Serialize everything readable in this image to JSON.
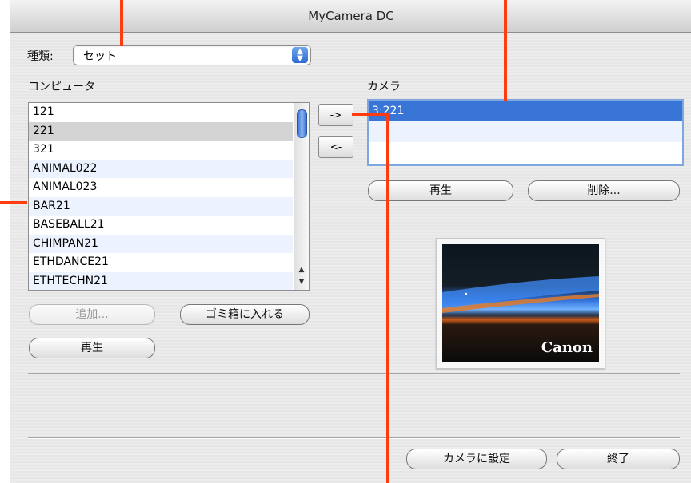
{
  "window": {
    "title": "MyCamera DC"
  },
  "kind": {
    "label": "種類:",
    "value": "セット"
  },
  "computer": {
    "label": "コンピュータ",
    "items": [
      "121",
      "221",
      "321",
      "ANIMAL022",
      "ANIMAL023",
      "BAR21",
      "BASEBALL21",
      "CHIMPAN21",
      "ETHDANCE21",
      "ETHTECHN21"
    ],
    "selected": "221"
  },
  "transfer": {
    "to_camera": "->",
    "to_computer": "<-"
  },
  "camera": {
    "label": "カメラ",
    "items": [
      "3:221"
    ],
    "selected": "3:221"
  },
  "buttons": {
    "camera_play": "再生",
    "delete": "削除...",
    "add": "追加...",
    "trash": "ゴミ箱に入れる",
    "computer_play": "再生",
    "set_to_camera": "カメラに設定",
    "quit": "終了"
  },
  "preview": {
    "logo_text": "Canon"
  },
  "colors": {
    "annotation": "#ff3b10",
    "selection": "#3875d7"
  }
}
